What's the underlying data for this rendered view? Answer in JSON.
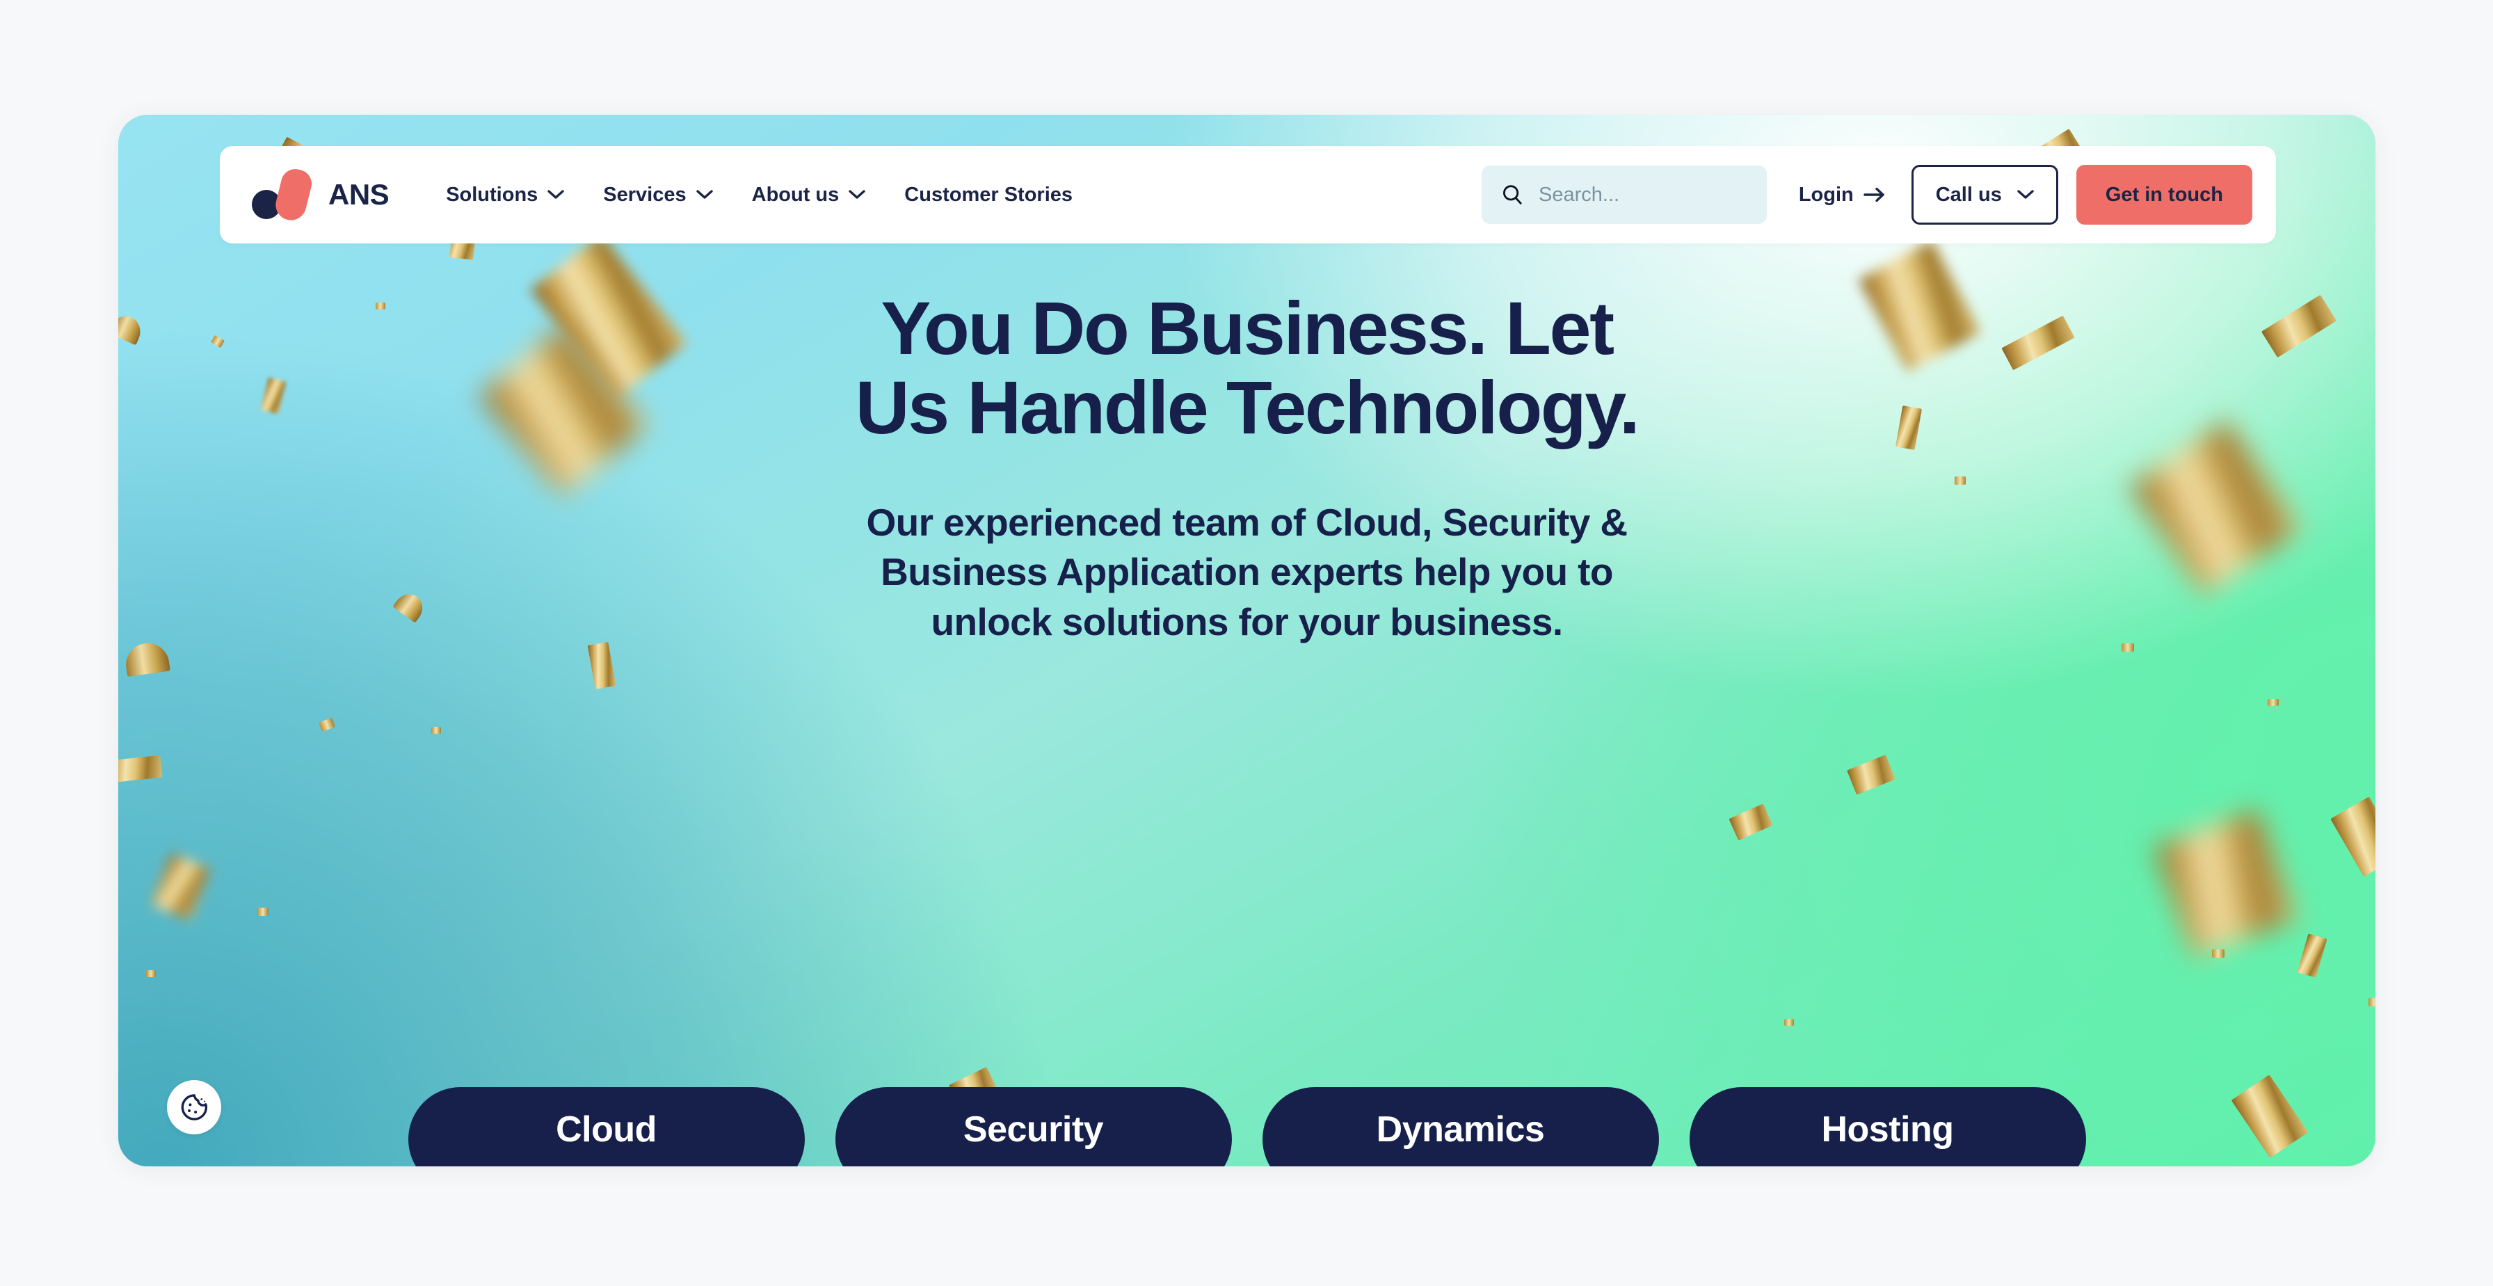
{
  "brand": {
    "name": "ANS",
    "logo_icon": "ans-logo-mark",
    "dot_color": "#1b2447",
    "blade_color": "#ef6f68"
  },
  "nav": {
    "items": [
      {
        "label": "Solutions",
        "has_dropdown": true,
        "icon": "chevron-down-icon"
      },
      {
        "label": "Services",
        "has_dropdown": true,
        "icon": "chevron-down-icon"
      },
      {
        "label": "About us",
        "has_dropdown": true,
        "icon": "chevron-down-icon"
      },
      {
        "label": "Customer Stories",
        "has_dropdown": false,
        "icon": ""
      }
    ]
  },
  "search": {
    "placeholder": "Search...",
    "value": "",
    "icon": "search-icon",
    "background": "#e3f2f5"
  },
  "actions": {
    "login_label": "Login",
    "login_icon": "arrow-right-icon",
    "callus_label": "Call us",
    "callus_icon": "chevron-down-icon",
    "cta_label": "Get in touch",
    "cta_color": "#ef6f68"
  },
  "hero": {
    "title_line1": "You Do Business. Let",
    "title_line2": "Us Handle Technology.",
    "subtitle_line1": "Our experienced team of Cloud, Security &",
    "subtitle_line2": "Business Application experts help you to",
    "subtitle_line3": "unlock solutions for your business.",
    "text_color": "#16204a"
  },
  "pills": [
    {
      "label": "Cloud"
    },
    {
      "label": "Security"
    },
    {
      "label": "Dynamics"
    },
    {
      "label": "Hosting"
    }
  ],
  "cookie": {
    "icon": "cookie-icon",
    "aria_label": "Cookie settings"
  },
  "theme": {
    "page_background": "#f7f8f9",
    "navy": "#16204a",
    "coral": "#ef6f68",
    "cyan": "#97e3f2",
    "mint": "#62f0ab",
    "teal": "#43a9bd"
  }
}
